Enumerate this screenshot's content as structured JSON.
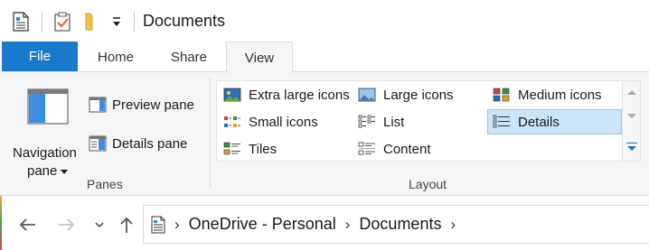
{
  "window": {
    "title": "Documents"
  },
  "tabs": [
    {
      "label": "File"
    },
    {
      "label": "Home"
    },
    {
      "label": "Share"
    },
    {
      "label": "View"
    }
  ],
  "active_tab": "View",
  "ribbon": {
    "panes": {
      "group_label": "Panes",
      "navigation_pane_line1": "Navigation",
      "navigation_pane_line2": "pane",
      "preview_pane": "Preview pane",
      "details_pane": "Details pane"
    },
    "layout": {
      "group_label": "Layout",
      "items": [
        {
          "label": "Extra large icons"
        },
        {
          "label": "Large icons"
        },
        {
          "label": "Medium icons"
        },
        {
          "label": "Small icons"
        },
        {
          "label": "List"
        },
        {
          "label": "Details"
        },
        {
          "label": "Tiles"
        },
        {
          "label": "Content"
        }
      ],
      "selected": "Details"
    }
  },
  "address_bar": {
    "breadcrumbs": [
      {
        "label": "OneDrive - Personal"
      },
      {
        "label": "Documents"
      }
    ]
  },
  "colors": {
    "file_tab": "#1979ca",
    "ribbon_bg": "#f5f6f7",
    "selected_bg": "#cce4f7",
    "selected_border": "#99c9ef"
  }
}
